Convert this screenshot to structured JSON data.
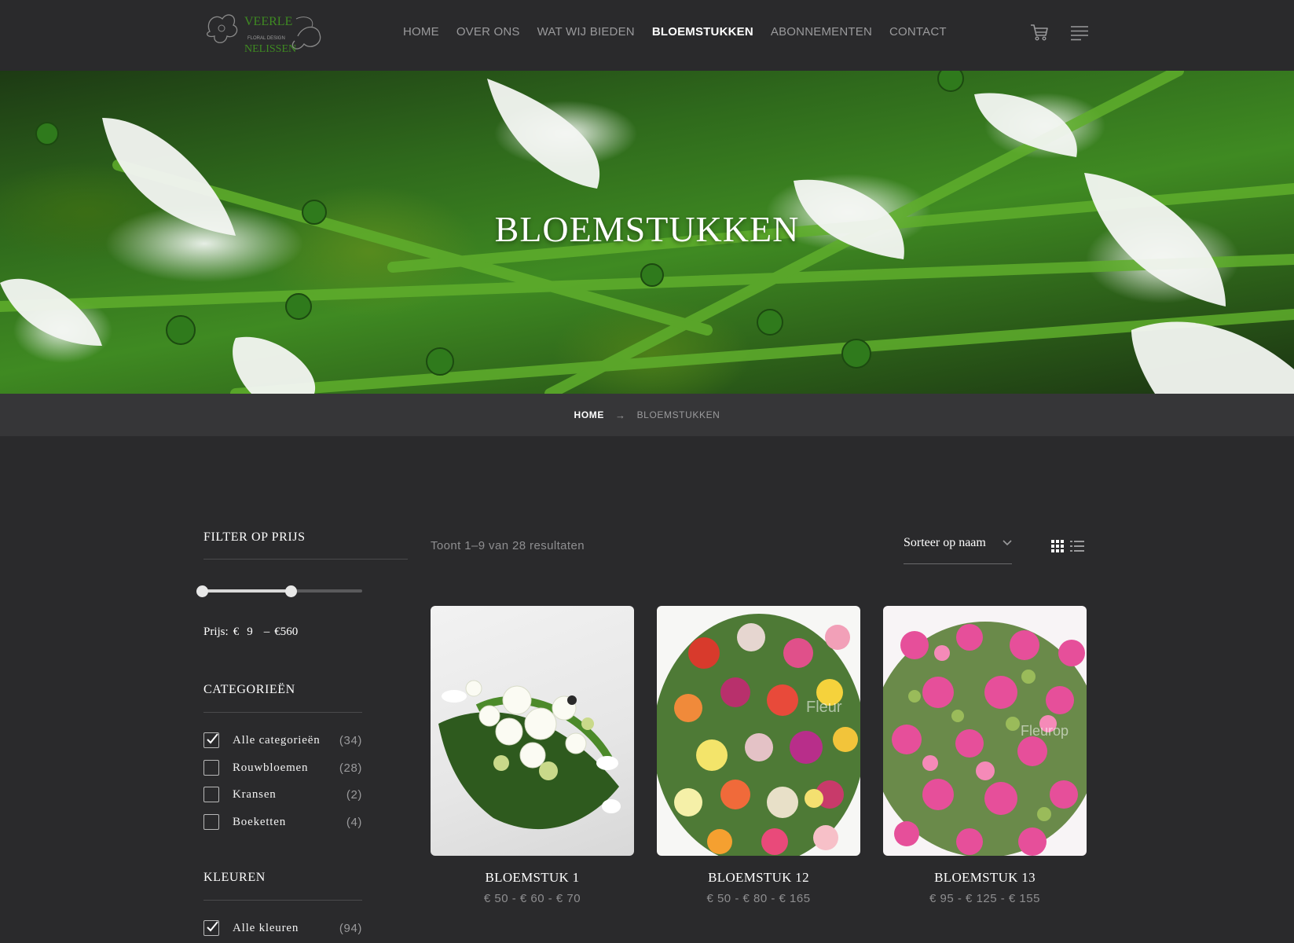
{
  "brand": {
    "logo_text_top": "VEERLE",
    "logo_text_mid": "FLORAL DESIGN",
    "logo_text_bottom": "NELISSEN"
  },
  "nav": {
    "items": [
      {
        "label": "HOME"
      },
      {
        "label": "OVER ONS"
      },
      {
        "label": "WAT WIJ BIEDEN"
      },
      {
        "label": "BLOEMSTUKKEN",
        "active": true
      },
      {
        "label": "ABONNEMENTEN"
      },
      {
        "label": "CONTACT"
      }
    ],
    "icons": [
      "cart-icon",
      "menu-icon"
    ]
  },
  "hero": {
    "title": "BLOEMSTUKKEN"
  },
  "breadcrumb": {
    "home": "HOME",
    "separator": "→",
    "current": "BLOEMSTUKKEN"
  },
  "sidebar": {
    "price_filter": {
      "heading": "FILTER OP PRIJS",
      "label": "Prijs:",
      "min_currency": "€",
      "min_value": "9",
      "dash": "–",
      "max_value": "€560",
      "slider_low_fraction": 0.0,
      "slider_high_fraction": 0.56
    },
    "categories": {
      "heading": "CATEGORIEËN",
      "items": [
        {
          "label": "Alle categorieën",
          "count": "(34)",
          "checked": true
        },
        {
          "label": "Rouwbloemen",
          "count": "(28)",
          "checked": false
        },
        {
          "label": "Kransen",
          "count": "(2)",
          "checked": false
        },
        {
          "label": "Boeketten",
          "count": "(4)",
          "checked": false
        }
      ]
    },
    "colors": {
      "heading": "KLEUREN",
      "items": [
        {
          "label": "Alle kleuren",
          "count": "(94)",
          "checked": true
        }
      ]
    }
  },
  "toolbar": {
    "results_text": "Toont 1–9 van 28 resultaten",
    "sort_label": "Sorteer op naam",
    "view_icons": [
      "grid-view-icon",
      "list-view-icon"
    ]
  },
  "products": [
    {
      "name": "BLOEMSTUK 1",
      "price": "€ 50 - € 60 - € 70"
    },
    {
      "name": "BLOEMSTUK 12",
      "price": "€ 50 - € 80 - € 165"
    },
    {
      "name": "BLOEMSTUK 13",
      "price": "€ 95 - € 125 - € 155"
    }
  ],
  "watermarks": {
    "p2": "Fleur",
    "p3": "Fleurop"
  },
  "colors": {
    "background": "#2a2a2c",
    "breadcrumb_bg": "#363638",
    "accent_green": "#3f8a22",
    "text_primary": "#ffffff",
    "text_muted": "#9a9a9c"
  }
}
